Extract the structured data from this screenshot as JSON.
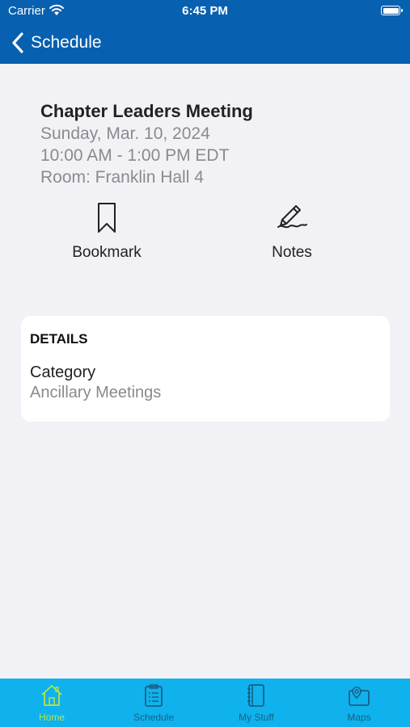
{
  "status_bar": {
    "carrier": "Carrier",
    "time": "6:45 PM"
  },
  "nav": {
    "back_label": "Schedule"
  },
  "event": {
    "title": "Chapter Leaders Meeting",
    "date": "Sunday, Mar. 10, 2024",
    "time": "10:00 AM - 1:00 PM EDT",
    "room": "Room: Franklin Hall 4"
  },
  "actions": {
    "bookmark_label": "Bookmark",
    "notes_label": "Notes"
  },
  "details": {
    "heading": "DETAILS",
    "category_label": "Category",
    "category_value": "Ancillary Meetings"
  },
  "tabbar": {
    "tabs": [
      {
        "label": "Home",
        "icon": "home-icon",
        "active": true
      },
      {
        "label": "Schedule",
        "icon": "clipboard-icon",
        "active": false
      },
      {
        "label": "My Stuff",
        "icon": "notebook-icon",
        "active": false
      },
      {
        "label": "Maps",
        "icon": "map-icon",
        "active": false
      }
    ]
  },
  "colors": {
    "nav_background": "#0760b0",
    "tabbar_background": "#0fb2ec",
    "active_tab": "#b4e24a",
    "page_background": "#f1f1f6"
  }
}
